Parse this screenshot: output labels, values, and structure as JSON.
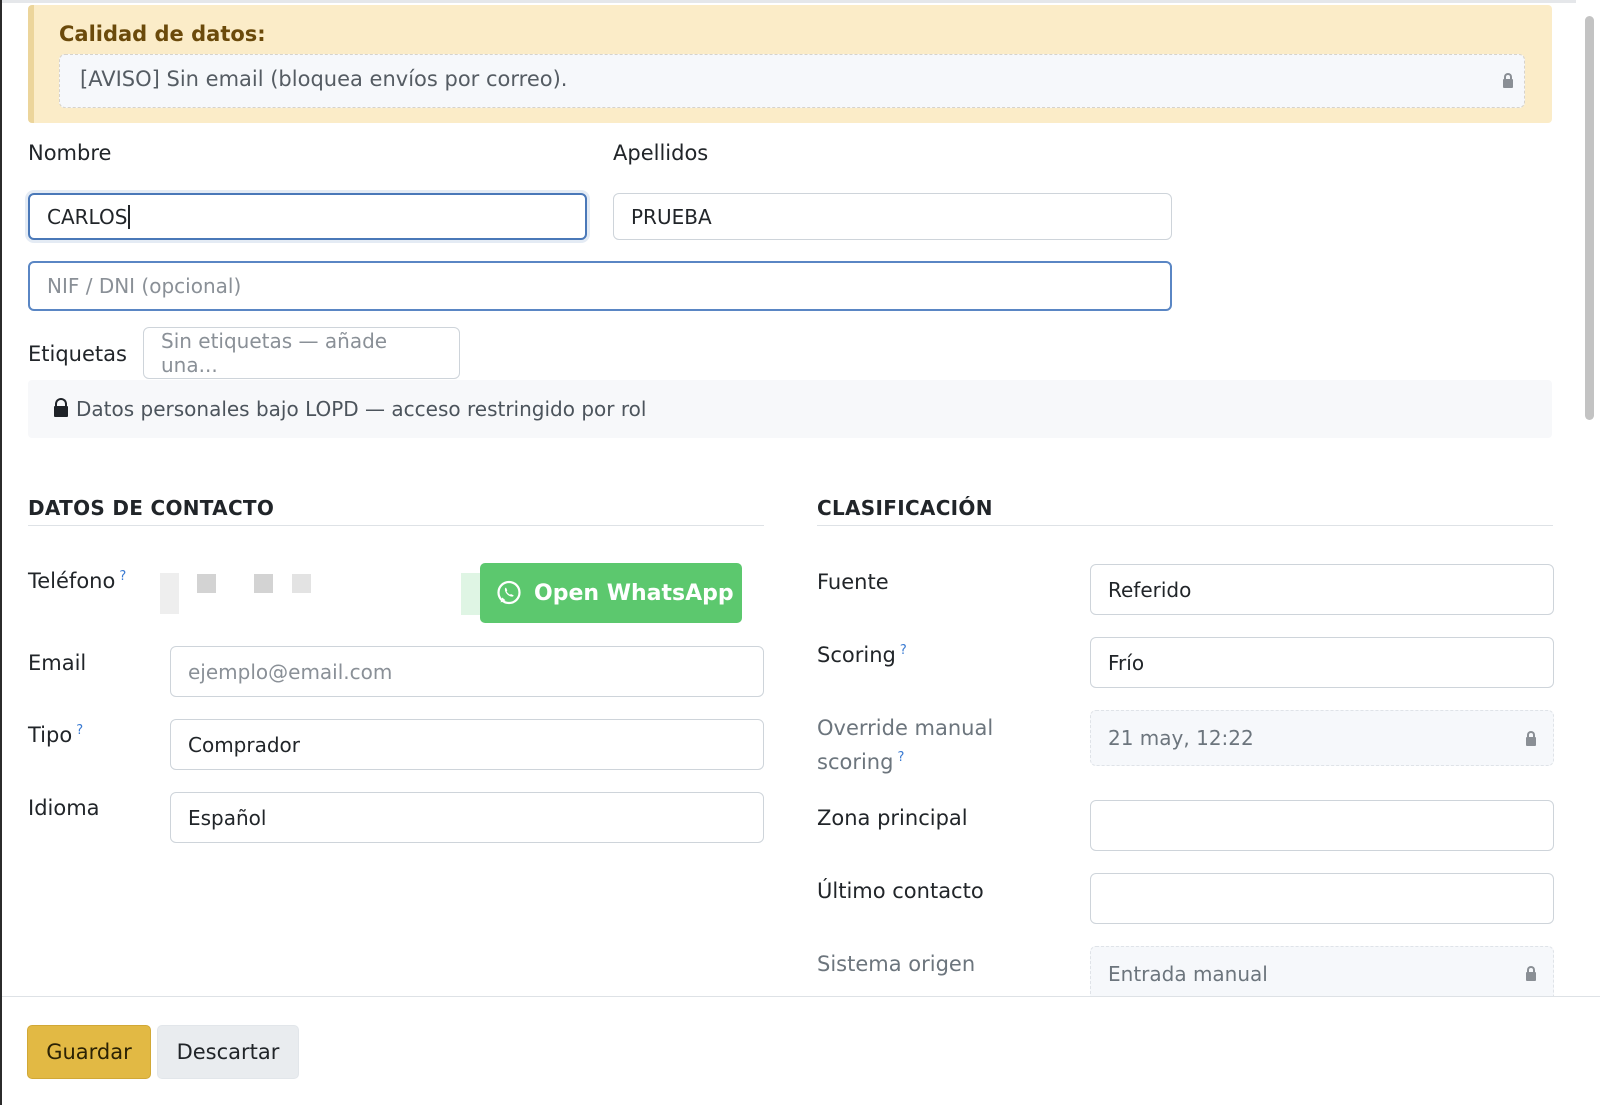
{
  "data_quality": {
    "title": "Calidad de datos:",
    "message": "[AVISO] Sin email (bloquea envíos por correo)."
  },
  "identity": {
    "nombre_label": "Nombre",
    "nombre_value": "CARLOS",
    "apellidos_label": "Apellidos",
    "apellidos_value": "PRUEBA",
    "nif_placeholder": "NIF / DNI (opcional)",
    "etiquetas_label": "Etiquetas",
    "etiquetas_placeholder": "Sin etiquetas — añade una..."
  },
  "privacy_note": "Datos personales bajo LOPD — acceso restringido por rol",
  "contact": {
    "section_title": "DATOS DE CONTACTO",
    "telefono_label": "Teléfono",
    "help_mark": "?",
    "whatsapp_label": "Open WhatsApp",
    "email_label": "Email",
    "email_placeholder": "ejemplo@email.com",
    "tipo_label": "Tipo",
    "tipo_value": "Comprador",
    "idioma_label": "Idioma",
    "idioma_value": "Español"
  },
  "classification": {
    "section_title": "CLASIFICACIÓN",
    "fuente_label": "Fuente",
    "fuente_value": "Referido",
    "scoring_label": "Scoring",
    "scoring_value": "Frío",
    "override_label_line1": "Override manual",
    "override_label_line2": "scoring",
    "override_value": "21 may, 12:22",
    "zona_label": "Zona principal",
    "zona_value": "",
    "ultimo_label": "Último contacto",
    "ultimo_value": "",
    "sistema_label": "Sistema origen",
    "sistema_value": "Entrada manual"
  },
  "footer": {
    "save_label": "Guardar",
    "discard_label": "Descartar"
  },
  "colors": {
    "warning_bg": "#fbecc8",
    "warning_title": "#6b4a0b",
    "whatsapp_green": "#5cc86e",
    "save_yellow": "#e2b944",
    "focus_blue": "#4a78b8"
  },
  "icons": [
    "lock-icon",
    "whatsapp-icon",
    "help-icon"
  ]
}
